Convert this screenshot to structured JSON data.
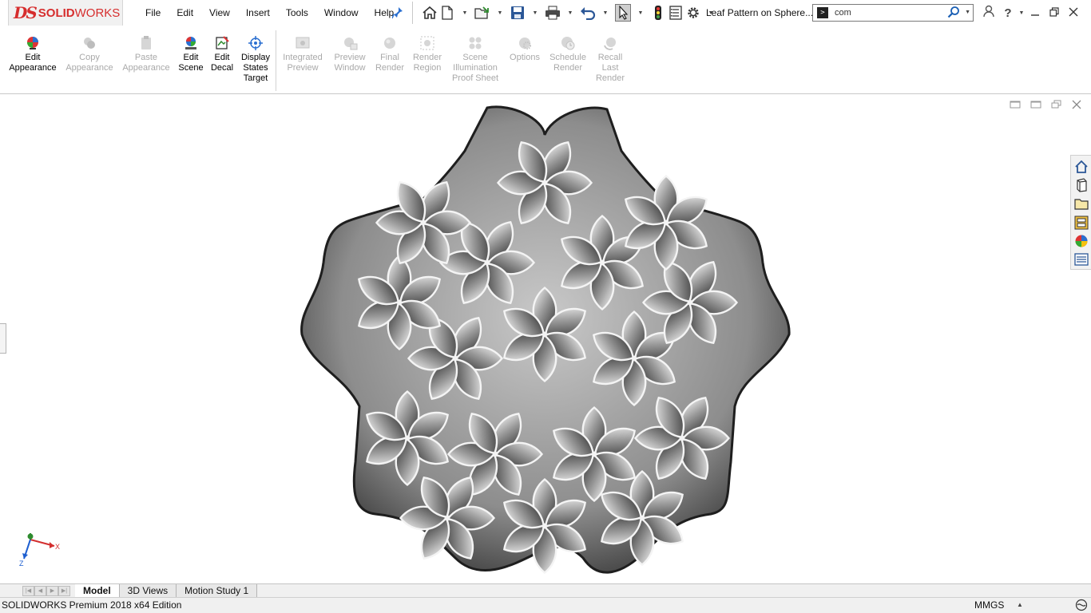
{
  "app": {
    "brand_ds": "DS",
    "brand_solid": "SOLID",
    "brand_works": "WORKS",
    "document_title": "Leaf Pattern on Sphere..."
  },
  "menu": [
    "File",
    "Edit",
    "View",
    "Insert",
    "Tools",
    "Window",
    "Help"
  ],
  "quick_access": {
    "icons": [
      "home-icon",
      "new-document-icon",
      "open-icon",
      "save-icon",
      "print-icon",
      "undo-icon",
      "select-icon",
      "rebuild-traffic-light-icon",
      "file-properties-icon",
      "options-gear-icon"
    ]
  },
  "search": {
    "value": "com",
    "cmd_glyph": ">"
  },
  "ribbon": {
    "active_items": [
      {
        "label_1": "Edit",
        "label_2": "Appearance",
        "label_3": ""
      },
      {
        "label_1": "Edit",
        "label_2": "Scene",
        "label_3": ""
      },
      {
        "label_1": "Edit",
        "label_2": "Decal",
        "label_3": ""
      },
      {
        "label_1": "Display",
        "label_2": "States",
        "label_3": "Target"
      }
    ],
    "disabled_items": [
      {
        "label_1": "Copy",
        "label_2": "Appearance",
        "label_3": ""
      },
      {
        "label_1": "Paste",
        "label_2": "Appearance",
        "label_3": ""
      },
      {
        "label_1": "Integrated",
        "label_2": "Preview",
        "label_3": ""
      },
      {
        "label_1": "Preview",
        "label_2": "Window",
        "label_3": ""
      },
      {
        "label_1": "Final",
        "label_2": "Render",
        "label_3": ""
      },
      {
        "label_1": "Render",
        "label_2": "Region",
        "label_3": ""
      },
      {
        "label_1": "Scene",
        "label_2": "Illumination",
        "label_3": "Proof Sheet"
      },
      {
        "label_1": "Options",
        "label_2": "",
        "label_3": ""
      },
      {
        "label_1": "Schedule",
        "label_2": "Render",
        "label_3": ""
      },
      {
        "label_1": "Recall",
        "label_2": "Last",
        "label_3": "Render"
      }
    ]
  },
  "task_pane": [
    "solidworks-resources-icon",
    "design-library-icon",
    "file-explorer-icon",
    "view-palette-icon",
    "appearances-icon",
    "custom-properties-icon"
  ],
  "triad": {
    "x_label": "X",
    "z_label": "Z"
  },
  "tabs": [
    {
      "label": "Model",
      "active": true
    },
    {
      "label": "3D Views",
      "active": false
    },
    {
      "label": "Motion Study 1",
      "active": false
    }
  ],
  "status": {
    "edition": "SOLIDWORKS Premium 2018 x64 Edition",
    "units": "MMGS"
  }
}
